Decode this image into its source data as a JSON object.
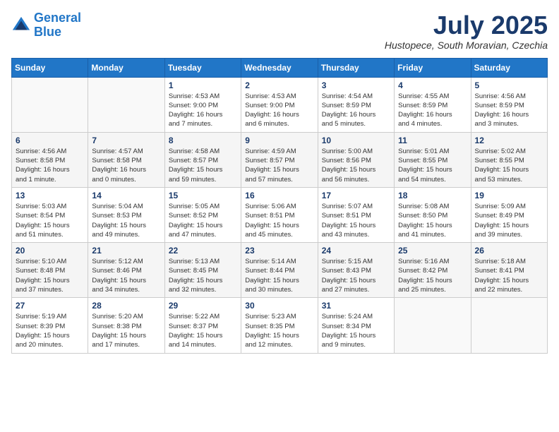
{
  "header": {
    "logo_line1": "General",
    "logo_line2": "Blue",
    "month": "July 2025",
    "location": "Hustopece, South Moravian, Czechia"
  },
  "weekdays": [
    "Sunday",
    "Monday",
    "Tuesday",
    "Wednesday",
    "Thursday",
    "Friday",
    "Saturday"
  ],
  "weeks": [
    [
      {
        "day": "",
        "info": ""
      },
      {
        "day": "",
        "info": ""
      },
      {
        "day": "1",
        "info": "Sunrise: 4:53 AM\nSunset: 9:00 PM\nDaylight: 16 hours\nand 7 minutes."
      },
      {
        "day": "2",
        "info": "Sunrise: 4:53 AM\nSunset: 9:00 PM\nDaylight: 16 hours\nand 6 minutes."
      },
      {
        "day": "3",
        "info": "Sunrise: 4:54 AM\nSunset: 8:59 PM\nDaylight: 16 hours\nand 5 minutes."
      },
      {
        "day": "4",
        "info": "Sunrise: 4:55 AM\nSunset: 8:59 PM\nDaylight: 16 hours\nand 4 minutes."
      },
      {
        "day": "5",
        "info": "Sunrise: 4:56 AM\nSunset: 8:59 PM\nDaylight: 16 hours\nand 3 minutes."
      }
    ],
    [
      {
        "day": "6",
        "info": "Sunrise: 4:56 AM\nSunset: 8:58 PM\nDaylight: 16 hours\nand 1 minute."
      },
      {
        "day": "7",
        "info": "Sunrise: 4:57 AM\nSunset: 8:58 PM\nDaylight: 16 hours\nand 0 minutes."
      },
      {
        "day": "8",
        "info": "Sunrise: 4:58 AM\nSunset: 8:57 PM\nDaylight: 15 hours\nand 59 minutes."
      },
      {
        "day": "9",
        "info": "Sunrise: 4:59 AM\nSunset: 8:57 PM\nDaylight: 15 hours\nand 57 minutes."
      },
      {
        "day": "10",
        "info": "Sunrise: 5:00 AM\nSunset: 8:56 PM\nDaylight: 15 hours\nand 56 minutes."
      },
      {
        "day": "11",
        "info": "Sunrise: 5:01 AM\nSunset: 8:55 PM\nDaylight: 15 hours\nand 54 minutes."
      },
      {
        "day": "12",
        "info": "Sunrise: 5:02 AM\nSunset: 8:55 PM\nDaylight: 15 hours\nand 53 minutes."
      }
    ],
    [
      {
        "day": "13",
        "info": "Sunrise: 5:03 AM\nSunset: 8:54 PM\nDaylight: 15 hours\nand 51 minutes."
      },
      {
        "day": "14",
        "info": "Sunrise: 5:04 AM\nSunset: 8:53 PM\nDaylight: 15 hours\nand 49 minutes."
      },
      {
        "day": "15",
        "info": "Sunrise: 5:05 AM\nSunset: 8:52 PM\nDaylight: 15 hours\nand 47 minutes."
      },
      {
        "day": "16",
        "info": "Sunrise: 5:06 AM\nSunset: 8:51 PM\nDaylight: 15 hours\nand 45 minutes."
      },
      {
        "day": "17",
        "info": "Sunrise: 5:07 AM\nSunset: 8:51 PM\nDaylight: 15 hours\nand 43 minutes."
      },
      {
        "day": "18",
        "info": "Sunrise: 5:08 AM\nSunset: 8:50 PM\nDaylight: 15 hours\nand 41 minutes."
      },
      {
        "day": "19",
        "info": "Sunrise: 5:09 AM\nSunset: 8:49 PM\nDaylight: 15 hours\nand 39 minutes."
      }
    ],
    [
      {
        "day": "20",
        "info": "Sunrise: 5:10 AM\nSunset: 8:48 PM\nDaylight: 15 hours\nand 37 minutes."
      },
      {
        "day": "21",
        "info": "Sunrise: 5:12 AM\nSunset: 8:46 PM\nDaylight: 15 hours\nand 34 minutes."
      },
      {
        "day": "22",
        "info": "Sunrise: 5:13 AM\nSunset: 8:45 PM\nDaylight: 15 hours\nand 32 minutes."
      },
      {
        "day": "23",
        "info": "Sunrise: 5:14 AM\nSunset: 8:44 PM\nDaylight: 15 hours\nand 30 minutes."
      },
      {
        "day": "24",
        "info": "Sunrise: 5:15 AM\nSunset: 8:43 PM\nDaylight: 15 hours\nand 27 minutes."
      },
      {
        "day": "25",
        "info": "Sunrise: 5:16 AM\nSunset: 8:42 PM\nDaylight: 15 hours\nand 25 minutes."
      },
      {
        "day": "26",
        "info": "Sunrise: 5:18 AM\nSunset: 8:41 PM\nDaylight: 15 hours\nand 22 minutes."
      }
    ],
    [
      {
        "day": "27",
        "info": "Sunrise: 5:19 AM\nSunset: 8:39 PM\nDaylight: 15 hours\nand 20 minutes."
      },
      {
        "day": "28",
        "info": "Sunrise: 5:20 AM\nSunset: 8:38 PM\nDaylight: 15 hours\nand 17 minutes."
      },
      {
        "day": "29",
        "info": "Sunrise: 5:22 AM\nSunset: 8:37 PM\nDaylight: 15 hours\nand 14 minutes."
      },
      {
        "day": "30",
        "info": "Sunrise: 5:23 AM\nSunset: 8:35 PM\nDaylight: 15 hours\nand 12 minutes."
      },
      {
        "day": "31",
        "info": "Sunrise: 5:24 AM\nSunset: 8:34 PM\nDaylight: 15 hours\nand 9 minutes."
      },
      {
        "day": "",
        "info": ""
      },
      {
        "day": "",
        "info": ""
      }
    ]
  ]
}
